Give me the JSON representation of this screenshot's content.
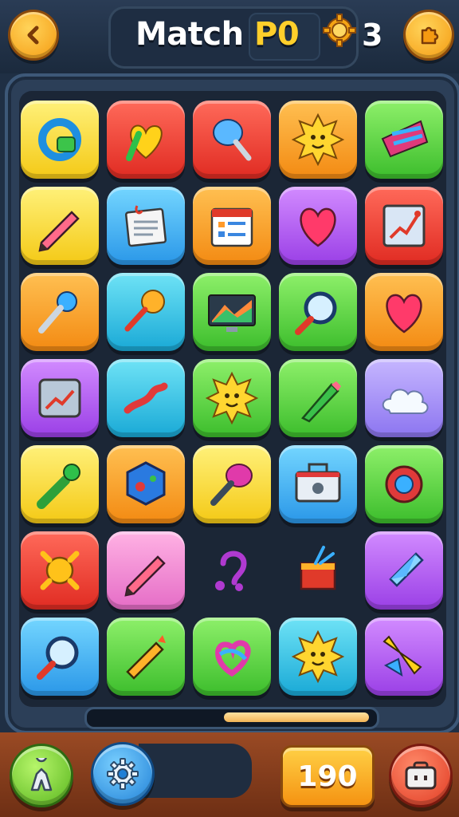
{
  "header": {
    "title_main": "Match ",
    "title_accent": "P0",
    "coins": "3",
    "back_icon": "chevron-left-icon",
    "menu_icon": "puzzle-icon",
    "coin_icon": "gear-coin-icon"
  },
  "board": {
    "rows": [
      [
        {
          "name": "ring-icon",
          "color": "yellow"
        },
        {
          "name": "heart-brush-icon",
          "color": "red"
        },
        {
          "name": "balloon-icon",
          "color": "red"
        },
        {
          "name": "sun-face-icon",
          "color": "orange"
        },
        {
          "name": "spinning-top-icon",
          "color": "green"
        }
      ],
      [
        {
          "name": "pencil-icon",
          "color": "yellow"
        },
        {
          "name": "notepad-icon",
          "color": "blue"
        },
        {
          "name": "calendar-icon",
          "color": "orange"
        },
        {
          "name": "heart-icon",
          "color": "purple"
        },
        {
          "name": "chart-frame-icon",
          "color": "red"
        }
      ],
      [
        {
          "name": "pin-icon",
          "color": "orange"
        },
        {
          "name": "lollipop-icon",
          "color": "cyan"
        },
        {
          "name": "monitor-icon",
          "color": "green"
        },
        {
          "name": "magnifier-icon",
          "color": "green"
        },
        {
          "name": "heart-icon",
          "color": "orange"
        }
      ],
      [
        {
          "name": "tablet-graph-icon",
          "color": "purple"
        },
        {
          "name": "slingshot-icon",
          "color": "cyan"
        },
        {
          "name": "sun-face-icon",
          "color": "green"
        },
        {
          "name": "marker-icon",
          "color": "green"
        },
        {
          "name": "cloud-icon",
          "color": "lav"
        }
      ],
      [
        {
          "name": "brush-icon",
          "color": "yellow"
        },
        {
          "name": "hexagon-icon",
          "color": "orange"
        },
        {
          "name": "rattle-icon",
          "color": "yellow"
        },
        {
          "name": "toolbox-icon",
          "color": "blue"
        },
        {
          "name": "lifebuoy-icon",
          "color": "green"
        }
      ],
      [
        {
          "name": "sun-icon",
          "color": "red"
        },
        {
          "name": "pencil-icon",
          "color": "pink"
        },
        {
          "name": "hook-icon",
          "color": "empty"
        },
        {
          "name": "gift-box-icon",
          "color": "empty"
        },
        {
          "name": "kite-icon",
          "color": "purple"
        }
      ],
      [
        {
          "name": "magnifier-icon",
          "color": "blue"
        },
        {
          "name": "crayon-icon",
          "color": "green"
        },
        {
          "name": "swirl-heart-icon",
          "color": "green"
        },
        {
          "name": "sun-face-icon",
          "color": "cyan"
        },
        {
          "name": "rocket-icon",
          "color": "purple"
        }
      ]
    ]
  },
  "progress": {
    "value": 0.5
  },
  "footer": {
    "score": "190",
    "left_icon": "character-icon",
    "settings_icon": "gear-icon",
    "right_icon": "briefcase-icon"
  },
  "colors": {
    "yellow": "#f4c915",
    "red": "#e02b22",
    "orange": "#f38a12",
    "green": "#3cbd2c",
    "blue": "#2a97e8",
    "purple": "#9a3fe6",
    "cyan": "#19a9d6",
    "lav": "#8c75f0",
    "pink": "#e56cc6"
  }
}
